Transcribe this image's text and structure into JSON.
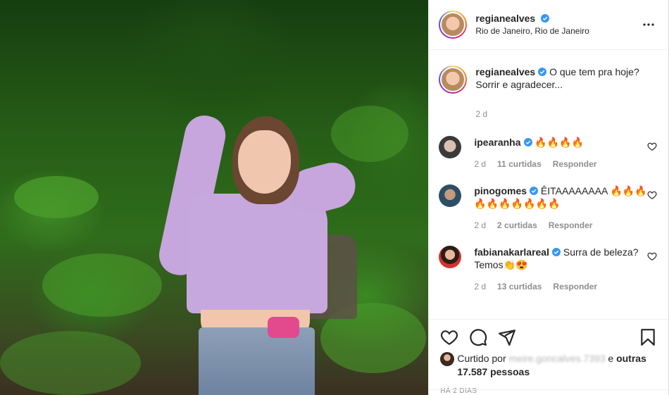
{
  "header": {
    "username": "regianealves",
    "location": "Rio de Janeiro, Rio de Janeiro",
    "more_icon": "more-horizontal-icon"
  },
  "caption": {
    "username": "regianealves",
    "text": "O que tem pra hoje? Sorrir e agradecer...",
    "time": "2 d"
  },
  "comments": [
    {
      "username": "ipearanha",
      "text": "🔥🔥🔥🔥",
      "time": "2 d",
      "likes": "11 curtidas",
      "reply": "Responder"
    },
    {
      "username": "pinogomes",
      "text": "ÊITAAAAAAAA 🔥🔥🔥🔥🔥🔥🔥🔥🔥🔥",
      "time": "2 d",
      "likes": "2 curtidas",
      "reply": "Responder"
    },
    {
      "username": "fabianakarlareal",
      "text": "Surra de beleza? Temos👏😍",
      "time": "2 d",
      "likes": "13 curtidas",
      "reply": "Responder"
    }
  ],
  "actions": {
    "liked_prefix": "Curtido por",
    "liked_user": "meire.goncalves.7393",
    "liked_and": "e",
    "liked_others": "outras 17.587 pessoas",
    "date": "HÁ 2 DIAS",
    "icons": [
      "heart-icon",
      "comment-icon",
      "share-icon",
      "bookmark-icon"
    ]
  },
  "colors": {
    "verified": "#3897f0",
    "text": "#262626",
    "muted": "#8e8e8e"
  }
}
